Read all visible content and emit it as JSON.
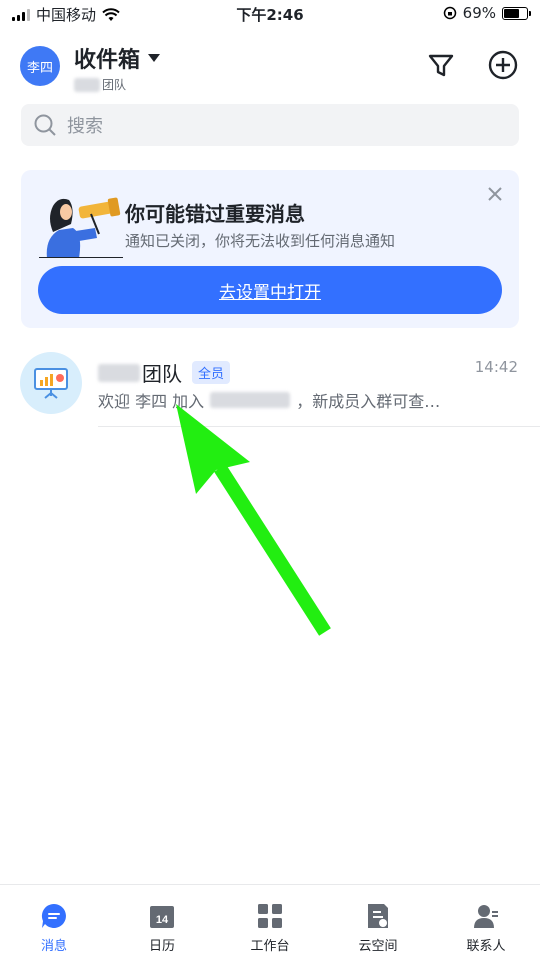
{
  "statusbar": {
    "carrier": "中国移动",
    "time": "下午2:46",
    "battery": "69%",
    "battery_level": 0.69
  },
  "header": {
    "avatar_text": "李四",
    "title": "收件箱",
    "subtitle_suffix": "团队"
  },
  "search": {
    "placeholder": "搜索"
  },
  "notice": {
    "title": "你可能错过重要消息",
    "description": "通知已关闭，你将无法收到任何消息通知",
    "button_label": "去设置中打开"
  },
  "chat": {
    "name_suffix": "团队",
    "badge": "全员",
    "time": "14:42",
    "preview_prefix": "欢迎 李四 加入",
    "preview_suffix": "，新成员入群可查…"
  },
  "tabs": [
    {
      "label": "消息",
      "icon": "message-icon",
      "active": true
    },
    {
      "label": "日历",
      "icon": "calendar-icon",
      "day": "14"
    },
    {
      "label": "工作台",
      "icon": "workspace-icon"
    },
    {
      "label": "云空间",
      "icon": "cloud-docs-icon"
    },
    {
      "label": "联系人",
      "icon": "contacts-icon"
    }
  ],
  "colors": {
    "accent": "#3370ff",
    "avatar": "#3f79f5",
    "notice_bg": "#f0f4ff",
    "arrow": "#22ee11"
  }
}
